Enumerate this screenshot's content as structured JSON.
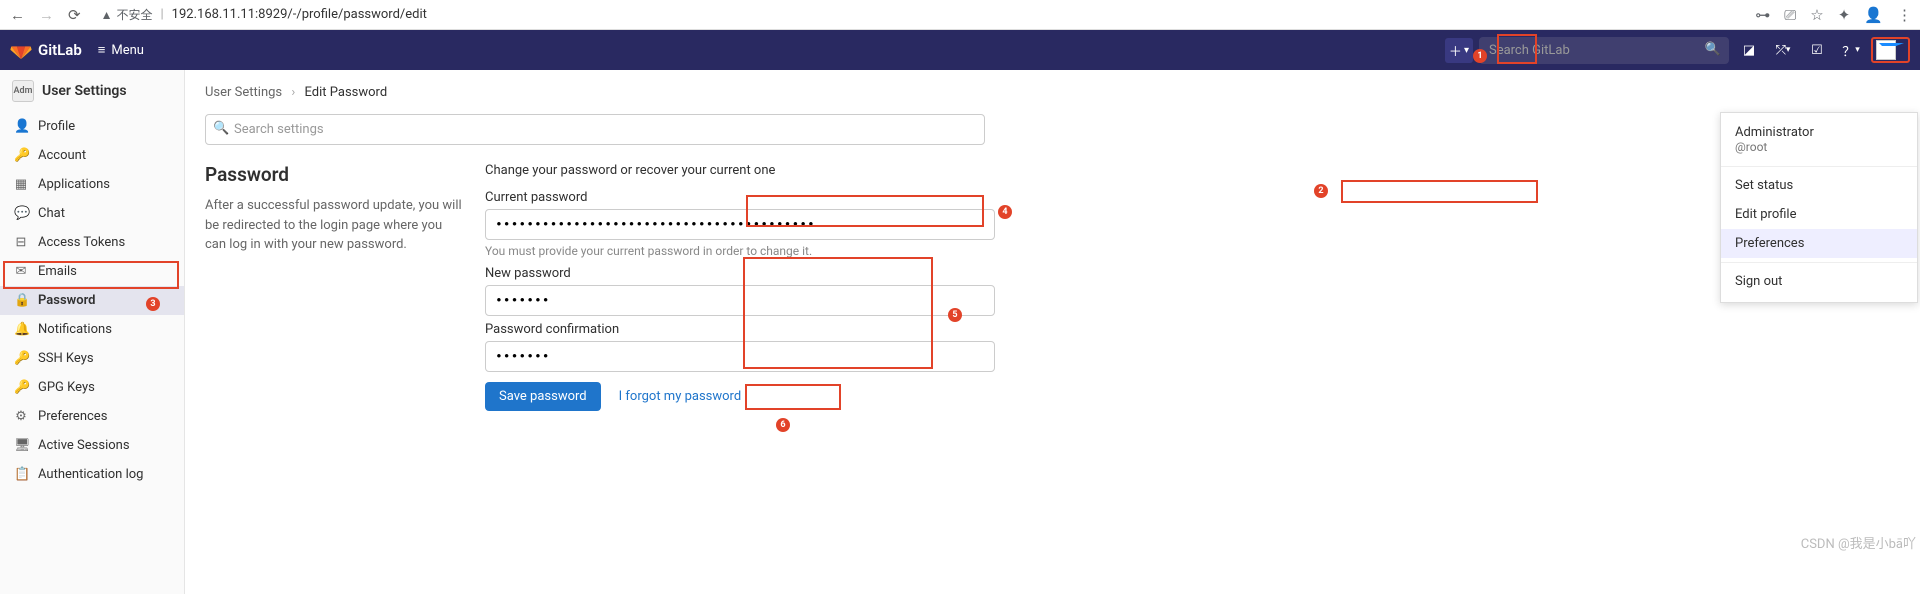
{
  "browser": {
    "insecure_text": "不安全",
    "url": "192.168.11.11:8929/-/profile/password/edit"
  },
  "nav": {
    "brand": "GitLab",
    "menu": "Menu",
    "search_placeholder": "Search GitLab"
  },
  "sidebar": {
    "title": "User Settings",
    "avatar_text": "Adm",
    "items": [
      {
        "label": "Profile",
        "icon": "👤"
      },
      {
        "label": "Account",
        "icon": "🔑"
      },
      {
        "label": "Applications",
        "icon": "▦"
      },
      {
        "label": "Chat",
        "icon": "💬"
      },
      {
        "label": "Access Tokens",
        "icon": "⊟"
      },
      {
        "label": "Emails",
        "icon": "✉"
      },
      {
        "label": "Password",
        "icon": "🔒",
        "active": true
      },
      {
        "label": "Notifications",
        "icon": "🔔"
      },
      {
        "label": "SSH Keys",
        "icon": "🔑"
      },
      {
        "label": "GPG Keys",
        "icon": "🔑"
      },
      {
        "label": "Preferences",
        "icon": "⚙"
      },
      {
        "label": "Active Sessions",
        "icon": "🖥"
      },
      {
        "label": "Authentication log",
        "icon": "📋"
      }
    ]
  },
  "crumbs": {
    "root": "User Settings",
    "current": "Edit Password"
  },
  "search_settings_placeholder": "Search settings",
  "form": {
    "title": "Password",
    "desc": "After a successful password update, you will be redirected to the login page where you can log in with your new password.",
    "right_hint": "Change your password or recover your current one",
    "current_label": "Current password",
    "current_value": "•••••••••••••••••••••••••••••••••••••••••",
    "current_help": "You must provide your current password in order to change it.",
    "new_label": "New password",
    "new_value": "•••••••",
    "confirm_label": "Password confirmation",
    "confirm_value": "•••••••",
    "save": "Save password",
    "forgot": "I forgot my password"
  },
  "dropdown": {
    "name": "Administrator",
    "handle": "@root",
    "set_status": "Set status",
    "edit_profile": "Edit profile",
    "preferences": "Preferences",
    "sign_out": "Sign out"
  },
  "watermark": "CSDN @我是小bā吖",
  "annotations": {
    "n1": "1",
    "n2": "2",
    "n3": "3",
    "n4": "4",
    "n5": "5",
    "n6": "6"
  }
}
